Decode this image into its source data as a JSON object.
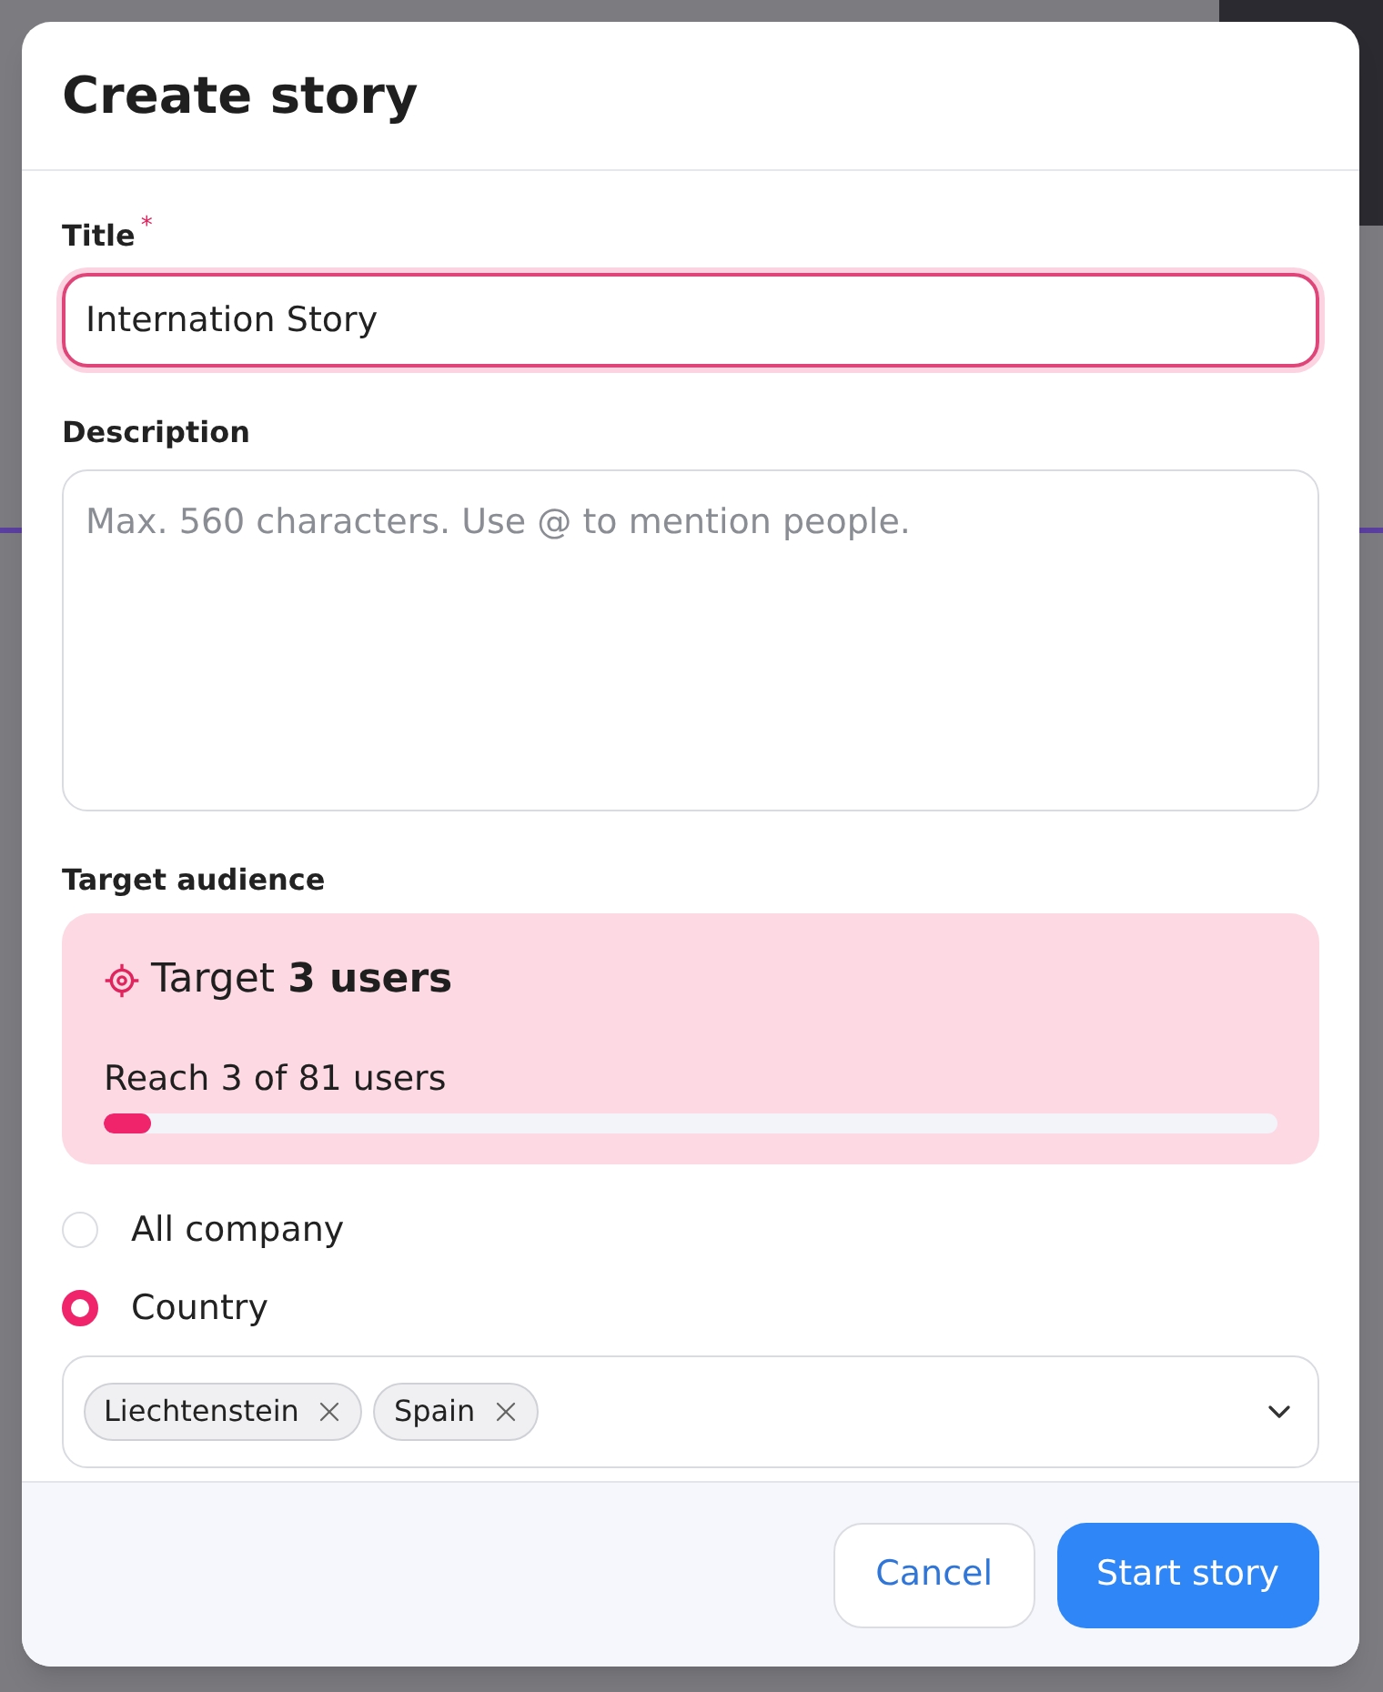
{
  "dialog": {
    "title": "Create story"
  },
  "title_field": {
    "label": "Title",
    "required_mark": "*",
    "value": "Internation Story"
  },
  "description_field": {
    "label": "Description",
    "placeholder": "Max. 560 characters. Use @ to mention people."
  },
  "target_audience": {
    "label": "Target audience",
    "target_prefix": "Target",
    "target_count": "3 users",
    "reach": "Reach 3 of 81 users",
    "level": 0.04
  },
  "audience_options": [
    {
      "label": "All company",
      "selected": false
    },
    {
      "label": "Country",
      "selected": true
    }
  ],
  "countries": [
    "Liechtenstein",
    "Spain"
  ],
  "buttons": [
    {
      "label": "Cancel",
      "kind": "secondary"
    },
    {
      "label": "Start story",
      "kind": "primary"
    }
  ]
}
